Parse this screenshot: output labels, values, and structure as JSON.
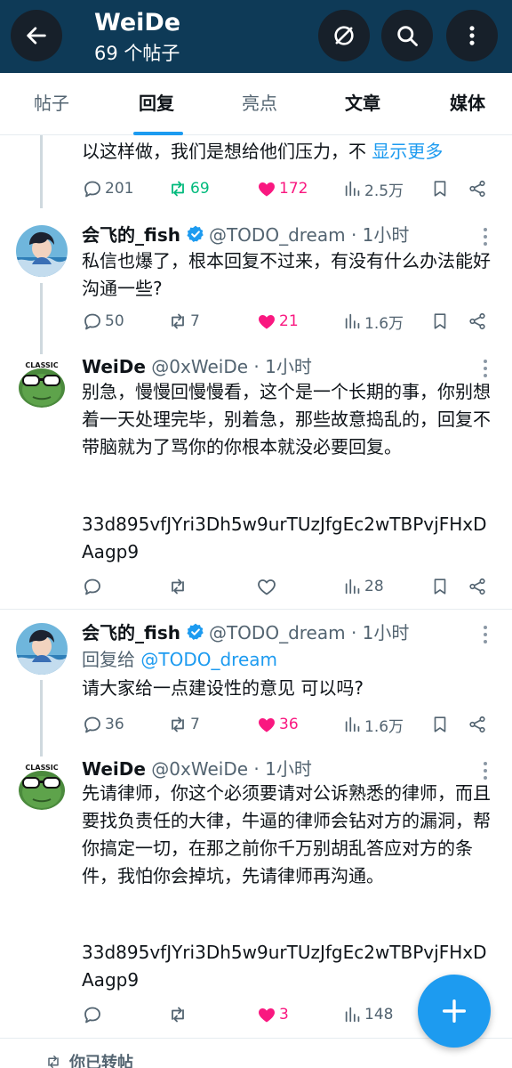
{
  "header": {
    "title": "WeiDe",
    "subtitle": "69 个帖子"
  },
  "tabs": [
    {
      "label": "帖子",
      "active": false
    },
    {
      "label": "回复",
      "active": true
    },
    {
      "label": "亮点",
      "active": false
    },
    {
      "label": "文章",
      "active": false
    },
    {
      "label": "媒体",
      "active": false
    }
  ],
  "colors": {
    "header_bg": "#0e3a57",
    "accent": "#1d9bf0",
    "like": "#f91880",
    "retweet": "#00ba7c"
  },
  "tweets": [
    {
      "body": "以这样做，我们是想给他们压力，不",
      "show_more": "显示更多",
      "replies": "201",
      "retweets": "69",
      "likes": "172",
      "views": "2.5万",
      "liked": true,
      "retweeted": true
    },
    {
      "name": "会飞的_fish",
      "verified": true,
      "handle": "@TODO_dream",
      "time": "· 1小时",
      "body": "私信也爆了，根本回复不过来，有没有什么办法能好沟通一些?",
      "replies": "50",
      "retweets": "7",
      "likes": "21",
      "views": "1.6万",
      "liked": true
    },
    {
      "name": "WeiDe",
      "handle": "@0xWeiDe",
      "time": "· 1小时",
      "body": "别急，慢慢回慢慢看，这个是一个长期的事，你别想着一天处理完毕，别着急，那些故意捣乱的，回复不带脑就为了骂你的你根本就没必要回复。",
      "code": "33d895vfJYri3Dh5w9urTUzJfgEc2wTBPvjFHxDAagp9",
      "views": "28"
    },
    {
      "name": "会飞的_fish",
      "verified": true,
      "handle": "@TODO_dream",
      "time": "· 1小时",
      "reply_prefix": "回复给",
      "reply_handle": "@TODO_dream",
      "body": "请大家给一点建设性的意见 可以吗?",
      "replies": "36",
      "retweets": "7",
      "likes": "36",
      "views": "1.6万",
      "liked": true
    },
    {
      "name": "WeiDe",
      "handle": "@0xWeiDe",
      "time": "· 1小时",
      "body": "先请律师，你这个必须要请对公诉熟悉的律师，而且要找负责任的大律，牛逼的律师会钻对方的漏洞，帮你搞定一切，在那之前你千万别胡乱答应对方的条件，我怕你会掉坑，先请律师再沟通。",
      "code": "33d895vfJYri3Dh5w9urTUzJfgEc2wTBPvjFHxDAagp9",
      "likes": "3",
      "views": "148",
      "liked": true
    }
  ],
  "bottom": {
    "retweeted_label": "你已转帖"
  },
  "icons": [
    "back-arrow-icon",
    "no-circle-icon",
    "search-icon",
    "more-vertical-icon",
    "reply-icon",
    "retweet-icon",
    "heart-icon",
    "views-icon",
    "bookmark-icon",
    "share-icon",
    "verified-badge-icon",
    "plus-icon"
  ]
}
